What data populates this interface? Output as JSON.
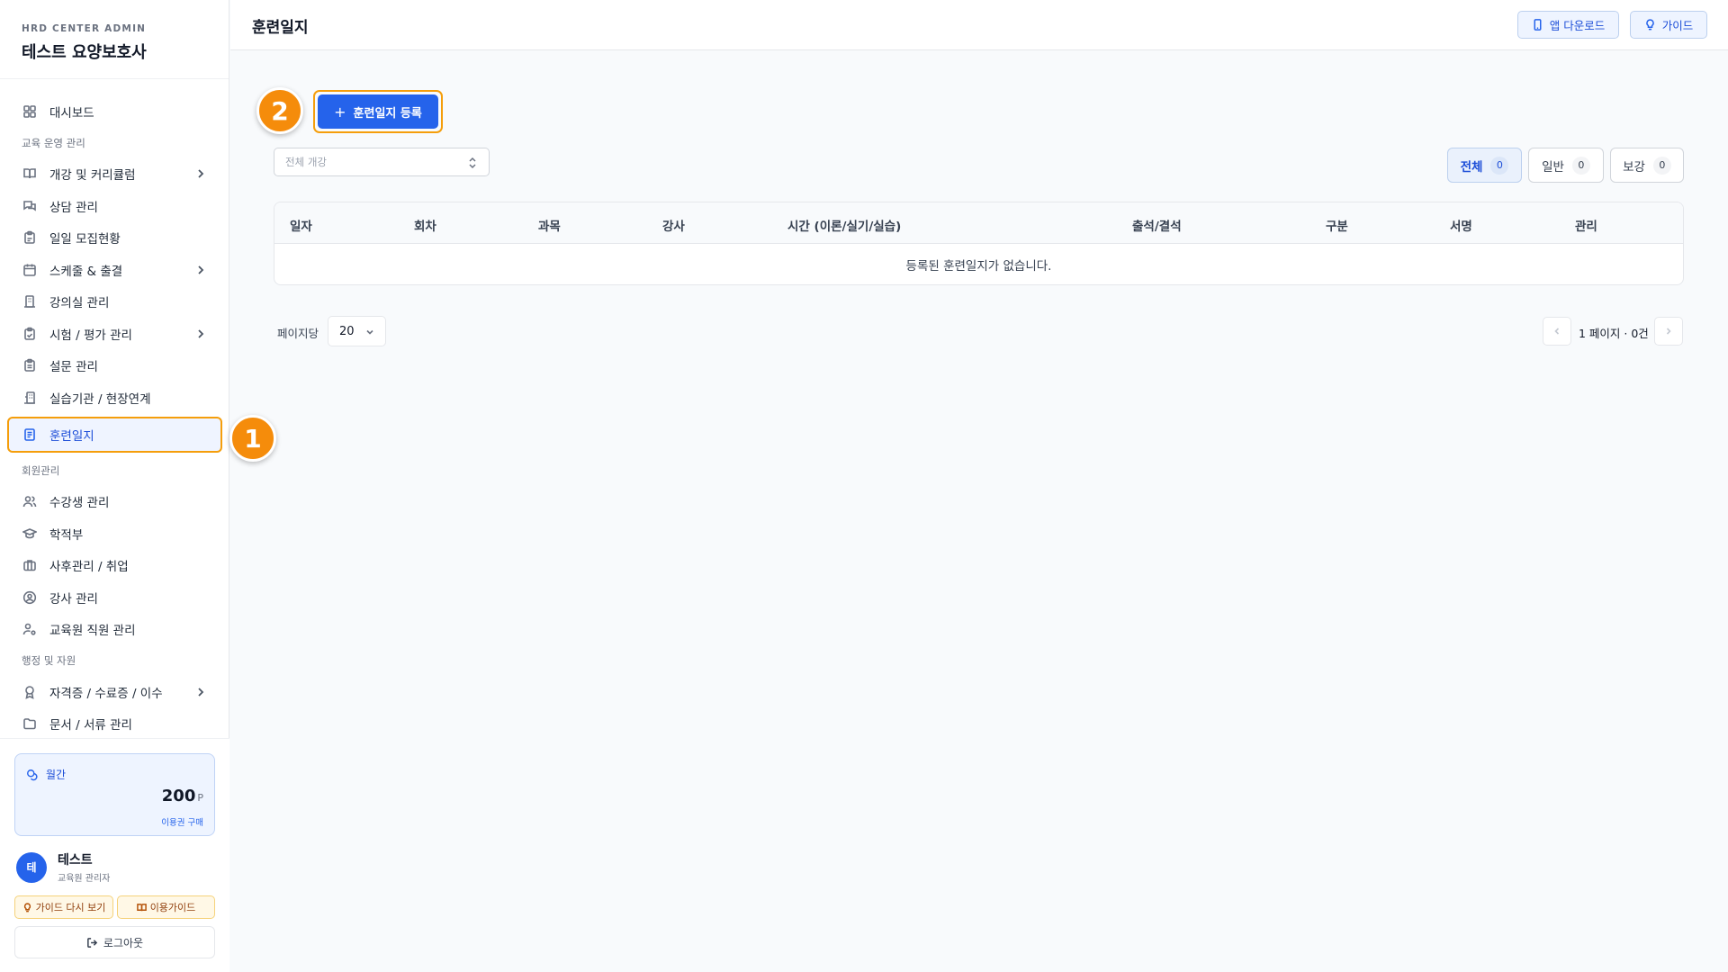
{
  "brand": {
    "subtitle": "HRD CENTER ADMIN",
    "title": "테스트 요양보호사"
  },
  "nav": {
    "dashboard": "대시보드",
    "section_ops": "교육 운영 관리",
    "course": "개강 및 커리큘럼",
    "consult": "상담 관리",
    "recruit": "일일 모집현황",
    "schedule": "스케줄 & 출결",
    "classroom": "강의실 관리",
    "exam": "시험 / 평가 관리",
    "survey": "설문 관리",
    "practice": "실습기관 / 현장연계",
    "journal": "훈련일지",
    "section_member": "회원관리",
    "students": "수강생 관리",
    "registry": "학적부",
    "aftercare": "사후관리 / 취업",
    "instructors": "강사 관리",
    "staff": "교육원 직원 관리",
    "section_admin": "행정 및 자원",
    "certificates": "자격증 / 수료증 / 이수",
    "documents": "문서 / 서류 관리"
  },
  "points": {
    "label": "월간",
    "value": "200",
    "unit": "P",
    "buy": "이용권 구매"
  },
  "user": {
    "avatar": "테",
    "name": "테스트",
    "role": "교육원 관리자"
  },
  "footer_buttons": {
    "guide_again": "가이드 다시 보기",
    "usage_guide": "이용가이드",
    "logout": "로그아웃"
  },
  "header": {
    "title": "훈련일지",
    "app_download": "앱 다운로드",
    "guide": "가이드"
  },
  "steps": {
    "one": "1",
    "two": "2"
  },
  "toolbar": {
    "register": "훈련일지 등록",
    "register_plus": "+",
    "course_select_placeholder": "전체 개강",
    "filters": [
      {
        "label": "전체",
        "count": "0"
      },
      {
        "label": "일반",
        "count": "0"
      },
      {
        "label": "보강",
        "count": "0"
      }
    ]
  },
  "table": {
    "headers": [
      "일자",
      "회차",
      "과목",
      "강사",
      "시간 (이론/실기/실습)",
      "출석/결석",
      "구분",
      "서명",
      "관리"
    ],
    "empty_message": "등록된 훈련일지가 없습니다."
  },
  "pagination": {
    "per_page_label": "페이지당",
    "per_page_value": "20",
    "info": "1 페이지 · 0건"
  },
  "colors": {
    "primary": "#2563eb",
    "highlight": "#f59e0b",
    "step_badge": "#f58c0b"
  }
}
